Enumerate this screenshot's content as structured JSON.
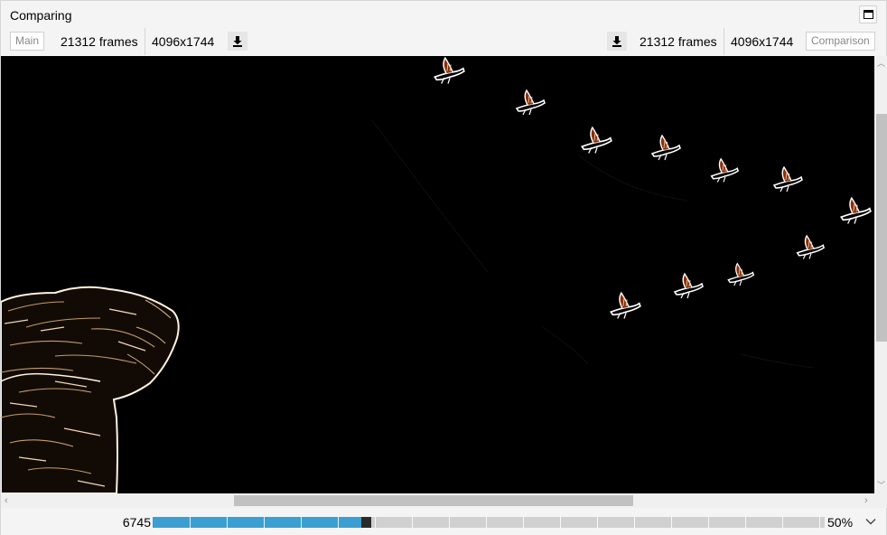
{
  "window": {
    "title": "Comparing"
  },
  "left": {
    "tag": "Main",
    "frames": "21312 frames",
    "resolution": "4096x1744"
  },
  "right": {
    "tag": "Comparison",
    "frames": "21312 frames",
    "resolution": "4096x1744"
  },
  "timeline": {
    "current_frame": "6745",
    "zoom": "50%",
    "progress_fraction": 0.31
  },
  "icons": {
    "maximize": "maximize-icon",
    "download": "download-icon",
    "scroll": [
      "chevron-up-icon",
      "chevron-down-icon",
      "chevron-left-icon",
      "chevron-right-icon"
    ],
    "zoom_dropdown": "chevron-down-icon"
  },
  "colors": {
    "timeline_fill": "#3b9fd1",
    "timeline_track": "#d0d0d0",
    "viewer_bg": "#000000"
  }
}
